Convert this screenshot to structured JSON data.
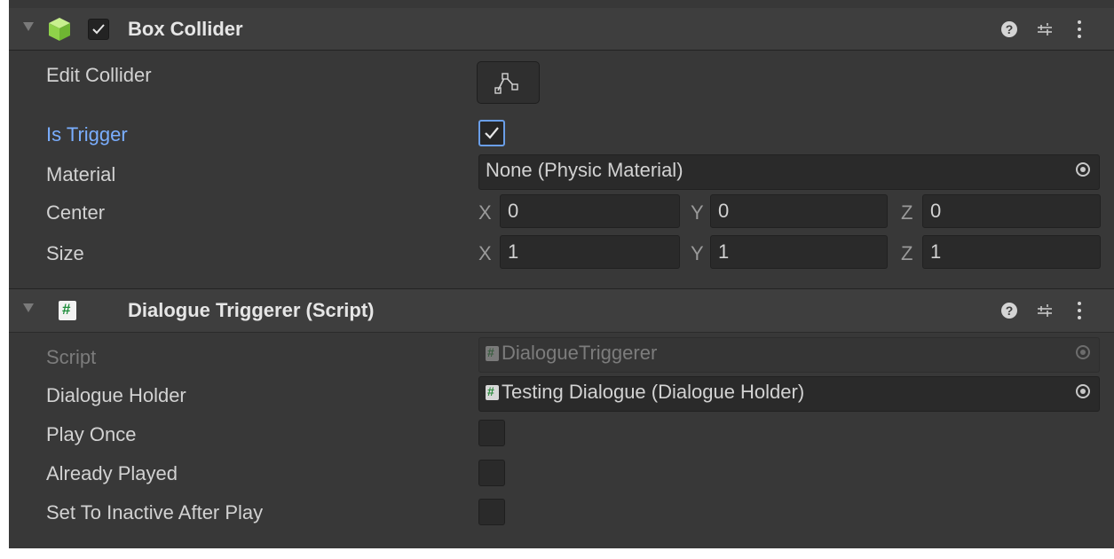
{
  "box_collider": {
    "title": "Box Collider",
    "edit_collider_label": "Edit Collider",
    "is_trigger_label": "Is Trigger",
    "is_trigger_checked": true,
    "material_label": "Material",
    "material_value": "None (Physic Material)",
    "center_label": "Center",
    "size_label": "Size",
    "axis_x": "X",
    "axis_y": "Y",
    "axis_z": "Z",
    "center": {
      "x": "0",
      "y": "0",
      "z": "0"
    },
    "size": {
      "x": "1",
      "y": "1",
      "z": "1"
    }
  },
  "dialogue_triggerer": {
    "title": "Dialogue Triggerer (Script)",
    "script_label": "Script",
    "script_value": "DialogueTriggerer",
    "dialogue_holder_label": "Dialogue Holder",
    "dialogue_holder_value": "Testing Dialogue (Dialogue Holder)",
    "play_once_label": "Play Once",
    "already_played_label": "Already Played",
    "set_inactive_label": "Set To Inactive After Play",
    "play_once_checked": false,
    "already_played_checked": false,
    "set_inactive_checked": false
  },
  "header_icons": [
    "help-icon",
    "preset-icon",
    "kebab-menu-icon"
  ],
  "colors": {
    "panel_bg": "#383838",
    "header_bg": "#3e3e3e",
    "field_bg": "#2a2a2a",
    "label_text": "#d2d2d2",
    "trigger_label_blue": "#7aaeff",
    "cube_green": "#9be25a",
    "script_hash_green": "#1e8d3b"
  }
}
